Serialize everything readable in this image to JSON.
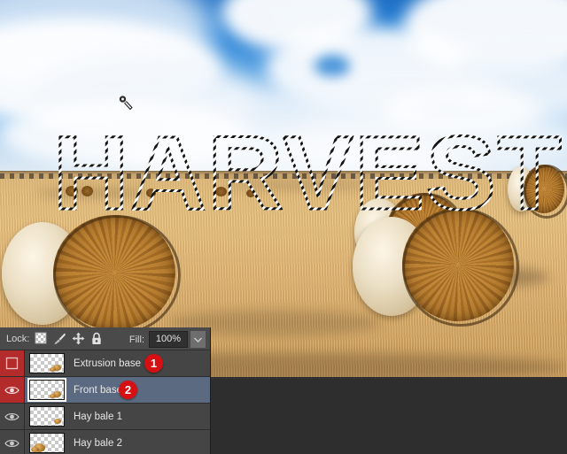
{
  "app": {
    "type": "photoshop-layers-panel",
    "canvas_bg": "#2e2e2e"
  },
  "artwork": {
    "title": "Hay bale field photograph with HARVEST text selection",
    "selection_text": "HARVEST",
    "cursor": "magic-wand-cursor",
    "sky_color": "#2f86d8",
    "field_color": "#dfb978"
  },
  "lock_bar": {
    "label": "Lock:",
    "icons": [
      {
        "name": "lock-transparent-pixels-icon",
        "glyph": "checkerboard"
      },
      {
        "name": "lock-image-pixels-icon",
        "glyph": "brush"
      },
      {
        "name": "lock-position-icon",
        "glyph": "move-arrows"
      },
      {
        "name": "lock-all-icon",
        "glyph": "padlock"
      }
    ],
    "fill_label": "Fill:",
    "fill_value": "100%",
    "fill_dropdown_icon": "chevron-down-icon"
  },
  "layers": [
    {
      "name": "Extrusion base",
      "visible": false,
      "selected": false,
      "eye_highlight": true,
      "badge": "1"
    },
    {
      "name": "Front base",
      "visible": true,
      "selected": true,
      "eye_highlight": true,
      "badge": "2"
    },
    {
      "name": "Hay bale 1",
      "visible": true,
      "selected": false,
      "eye_highlight": false,
      "badge": ""
    },
    {
      "name": "Hay bale 2",
      "visible": true,
      "selected": false,
      "eye_highlight": false,
      "badge": ""
    }
  ],
  "colors": {
    "badge_red": "#d50f12",
    "eye_flag_red": "#b42b2b",
    "selected_row": "#5b6a80",
    "panel_bg": "#3c3c3c",
    "lockbar_bg": "#4a4a4a"
  }
}
